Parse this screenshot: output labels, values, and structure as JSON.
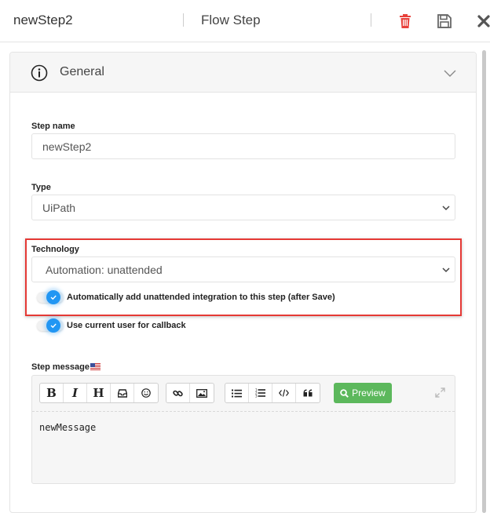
{
  "header": {
    "title": "newStep2",
    "subtitle": "Flow Step"
  },
  "colors": {
    "delete_icon": "#e8413b",
    "accent": "#2196f3",
    "preview_button": "#5cb85c",
    "highlight_border": "#e53935"
  },
  "panel": {
    "title": "General"
  },
  "form": {
    "step_name_label": "Step name",
    "step_name_value": "newStep2",
    "type_label": "Type",
    "type_value": "UiPath",
    "technology_label": "Technology",
    "technology_value": "Automation: unattended",
    "toggle_auto_integration": "Automatically add unattended integration to this step (after Save)",
    "toggle_current_user": "Use current user for callback",
    "step_message_label": "Step message"
  },
  "editor": {
    "preview_label": "Preview",
    "content": "newMessage"
  }
}
